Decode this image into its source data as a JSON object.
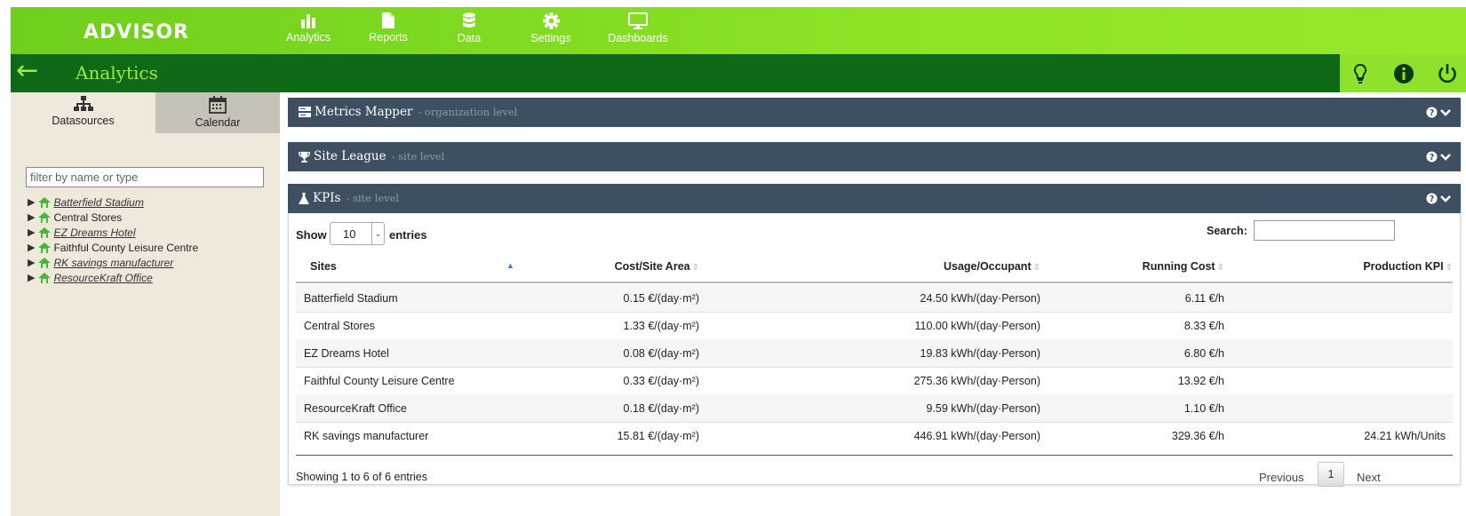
{
  "app": {
    "logo": "ADVISOR",
    "nav": [
      {
        "label": "Analytics",
        "icon": "bar-chart-icon"
      },
      {
        "label": "Reports",
        "icon": "document-icon"
      },
      {
        "label": "Data",
        "icon": "database-icon"
      },
      {
        "label": "Settings",
        "icon": "gear-icon"
      },
      {
        "label": "Dashboards",
        "icon": "monitor-icon"
      }
    ],
    "active_nav": "Analytics"
  },
  "titlebar": {
    "title": "Analytics",
    "back_icon": "arrow-left-icon",
    "actions": [
      "lightbulb-icon",
      "info-icon",
      "power-icon"
    ]
  },
  "sidebar": {
    "tabs": [
      {
        "label": "Datasources",
        "icon": "sitemap-icon",
        "active": true
      },
      {
        "label": "Calendar",
        "icon": "calendar-icon",
        "active": false
      }
    ],
    "filter_placeholder": "filter by name or type",
    "tree": [
      {
        "label": "Batterfield Stadium",
        "linked": true
      },
      {
        "label": "Central Stores",
        "linked": false
      },
      {
        "label": "EZ Dreams Hotel",
        "linked": true
      },
      {
        "label": "Faithful County Leisure Centre",
        "linked": false
      },
      {
        "label": "RK savings manufacturer",
        "linked": true
      },
      {
        "label": "ResourceKraft Office",
        "linked": true
      }
    ]
  },
  "panels": [
    {
      "title": "Metrics Mapper",
      "subtitle": "- organization level",
      "icon": "server-icon"
    },
    {
      "title": "Site League",
      "subtitle": "- site level",
      "icon": "trophy-icon"
    },
    {
      "title": "KPIs",
      "subtitle": "- site level",
      "icon": "flask-icon"
    }
  ],
  "kpi_table": {
    "show_label": "Show",
    "entries_value": "10",
    "entries_label": "entries",
    "search_label": "Search:",
    "columns": [
      "Sites",
      "Cost/Site Area",
      "Usage/Occupant",
      "Running Cost",
      "Production KPI"
    ],
    "rows": [
      {
        "site": "Batterfield Stadium",
        "cost": "0.15 €/(day·m²)",
        "usage": "24.50 kWh/(day·Person)",
        "running": "6.11 €/h",
        "production": ""
      },
      {
        "site": "Central Stores",
        "cost": "1.33 €/(day·m²)",
        "usage": "110.00 kWh/(day·Person)",
        "running": "8.33 €/h",
        "production": ""
      },
      {
        "site": "EZ Dreams Hotel",
        "cost": "0.08 €/(day·m²)",
        "usage": "19.83 kWh/(day·Person)",
        "running": "6.80 €/h",
        "production": ""
      },
      {
        "site": "Faithful County Leisure Centre",
        "cost": "0.33 €/(day·m²)",
        "usage": "275.36 kWh/(day·Person)",
        "running": "13.92 €/h",
        "production": ""
      },
      {
        "site": "ResourceKraft Office",
        "cost": "0.18 €/(day·m²)",
        "usage": "9.59 kWh/(day·Person)",
        "running": "1.10 €/h",
        "production": ""
      },
      {
        "site": "RK savings manufacturer",
        "cost": "15.81 €/(day·m²)",
        "usage": "446.91 kWh/(day·Person)",
        "running": "329.36 €/h",
        "production": "24.21 kWh/Units"
      }
    ],
    "info": "Showing 1 to 6 of 6 entries",
    "pagination": {
      "previous": "Previous",
      "current": "1",
      "next": "Next"
    }
  },
  "colors": {
    "brand_green": "#8ee326",
    "title_bar": "#0f6a17",
    "panel_header": "#3d4f60",
    "sidebar_bg": "#efe9dc"
  }
}
